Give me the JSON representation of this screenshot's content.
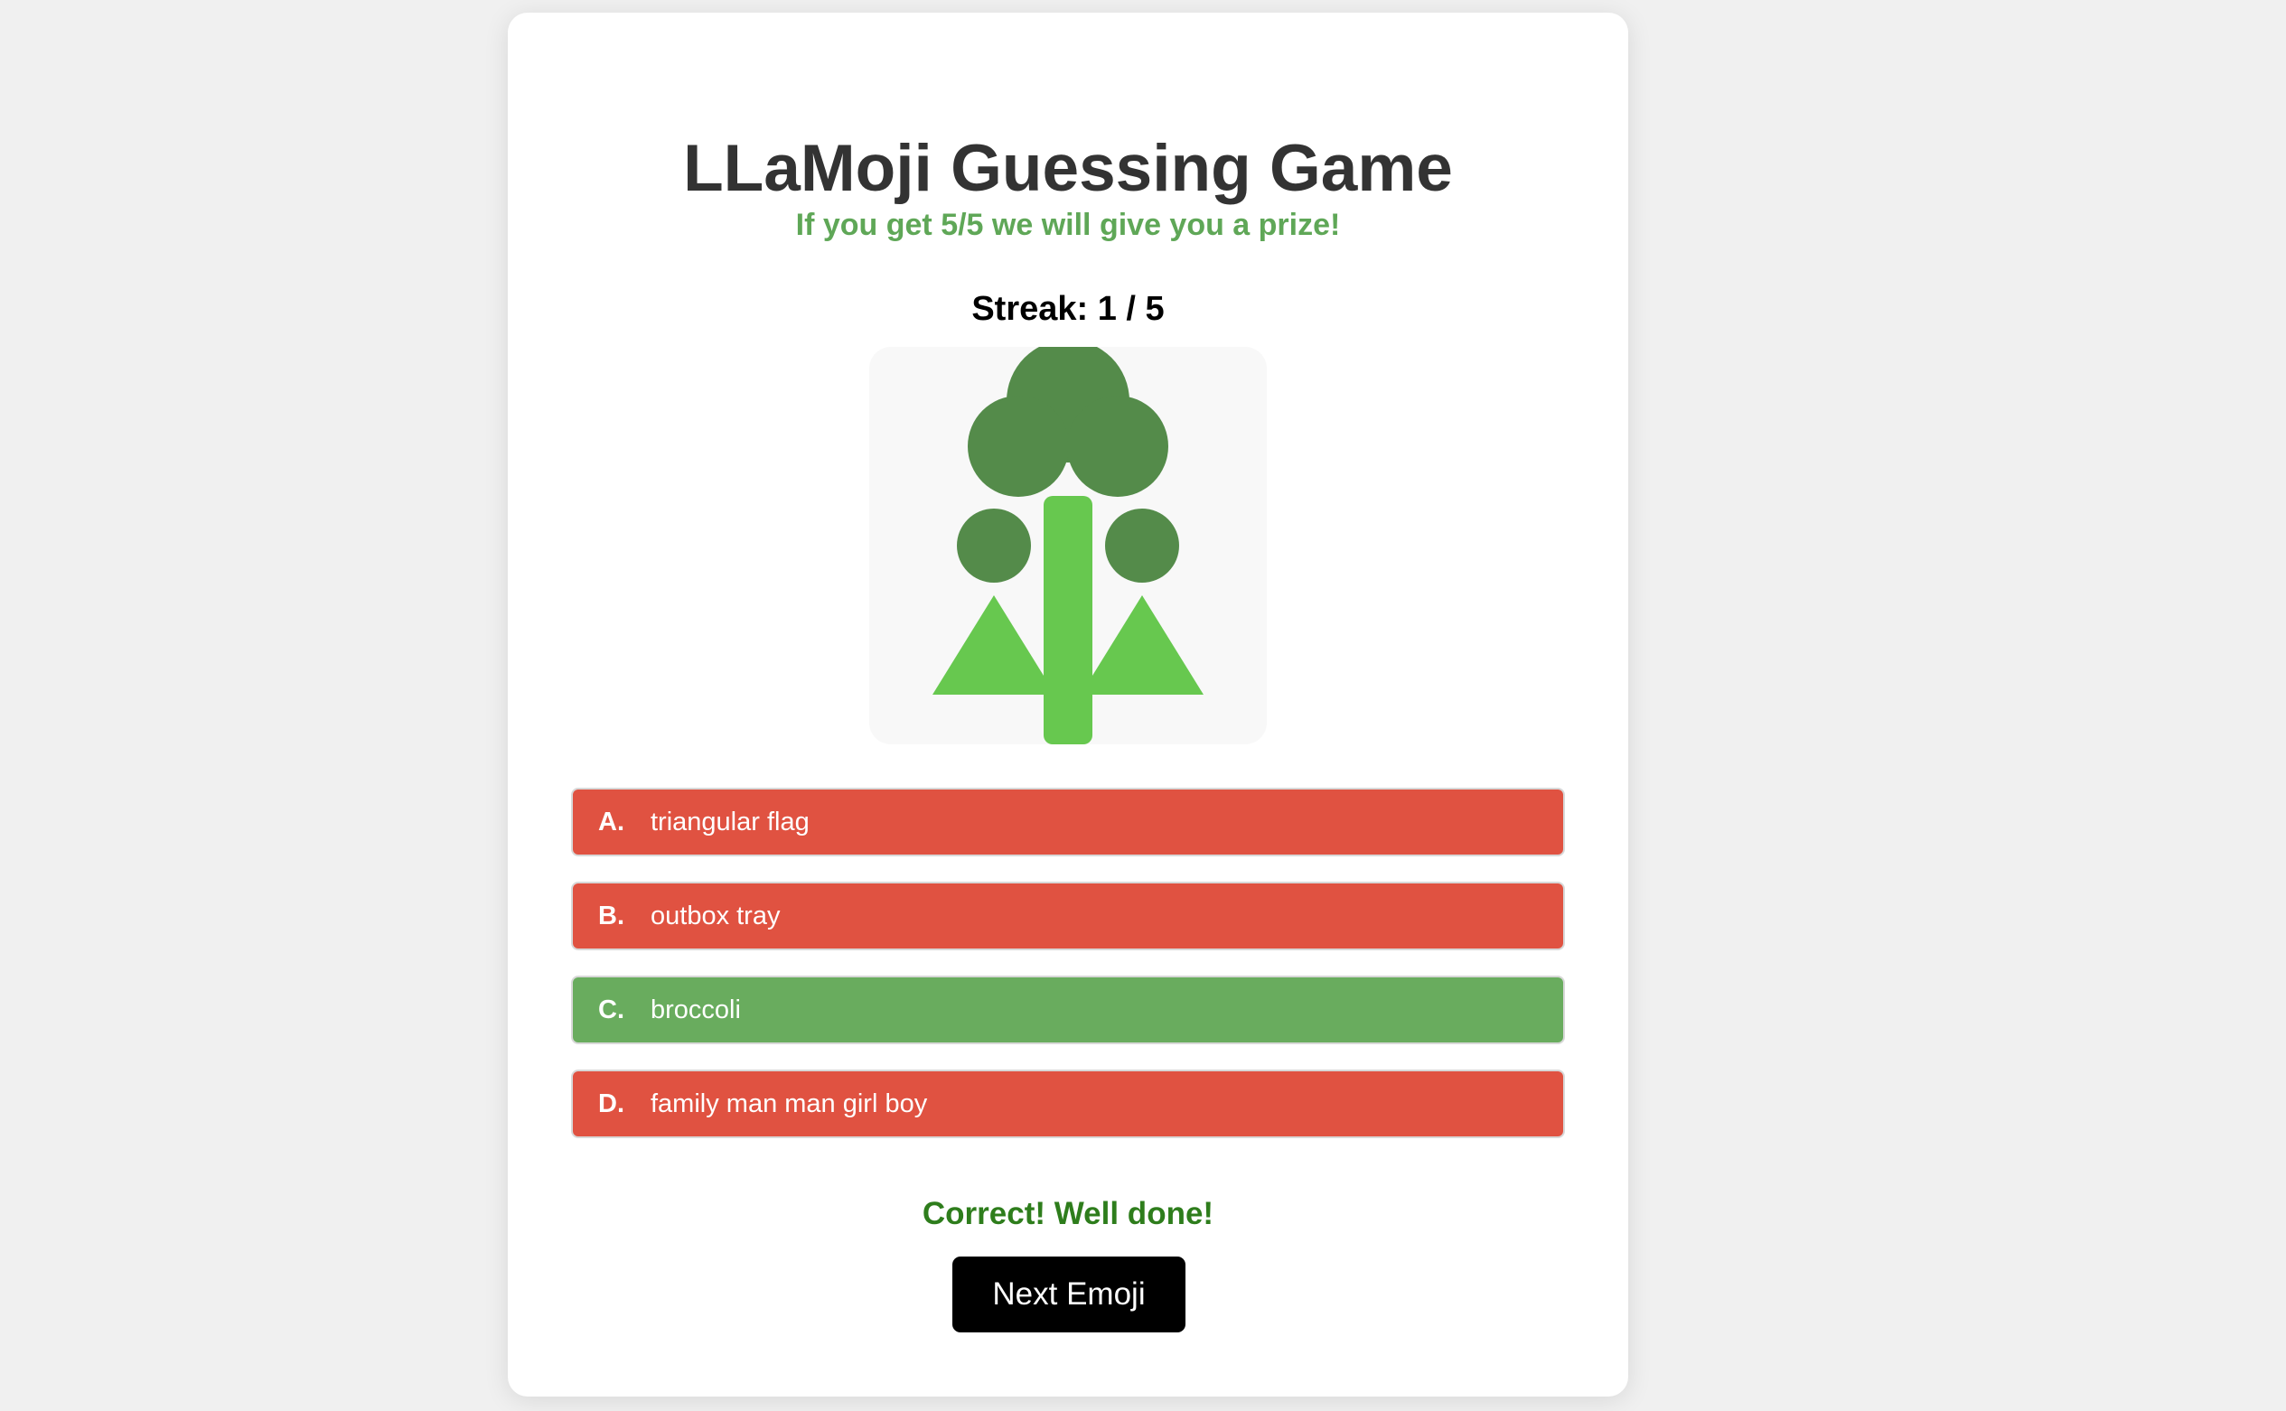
{
  "game": {
    "title": "LLaMoji Guessing Game",
    "subtitle": "If you get 5/5 we will give you a prize!",
    "streak": "Streak: 1 / 5",
    "emoji_icon": "broccoli-icon",
    "options": [
      {
        "letter": "A.",
        "text": "triangular flag",
        "state": "wrong"
      },
      {
        "letter": "B.",
        "text": "outbox tray",
        "state": "wrong"
      },
      {
        "letter": "C.",
        "text": "broccoli",
        "state": "correct"
      },
      {
        "letter": "D.",
        "text": "family man man girl boy",
        "state": "wrong"
      }
    ],
    "feedback": "Correct! Well done!",
    "next_label": "Next Emoji"
  },
  "colors": {
    "background": "#f0f0f0",
    "card": "#ffffff",
    "title": "#333333",
    "subtitle": "#5fa757",
    "wrong": "#e05241",
    "correct": "#69ac5e",
    "feedback": "#2e7d1c",
    "button": "#000000",
    "emoji_dark_green": "#548b4a",
    "emoji_light_green": "#67c84f"
  }
}
